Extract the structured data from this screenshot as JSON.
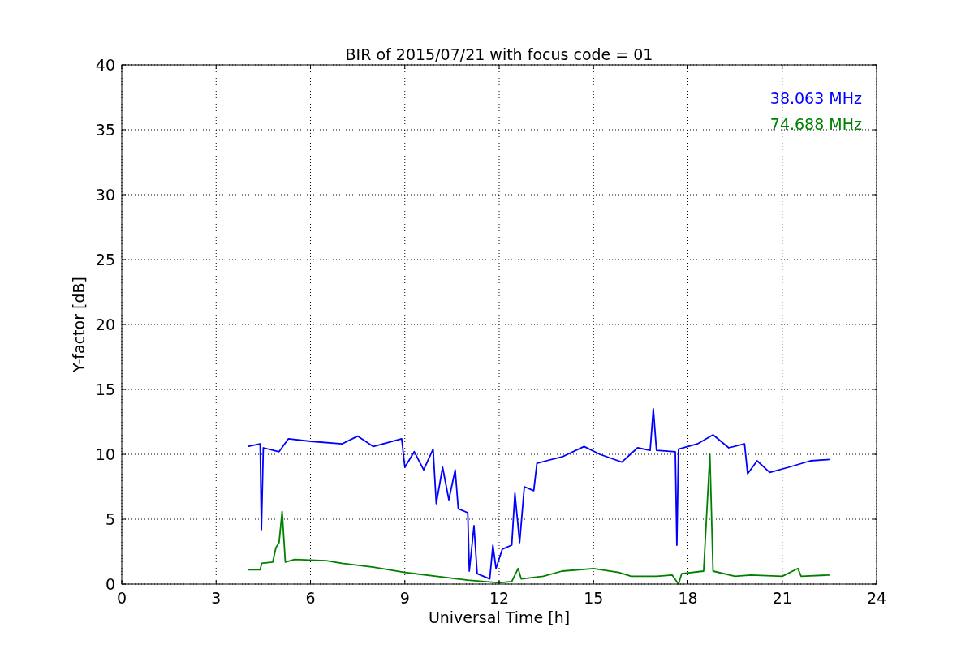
{
  "chart_data": {
    "type": "line",
    "title": "BIR of 2015/07/21 with focus code = 01",
    "xlabel": "Universal Time [h]",
    "ylabel": "Y-factor [dB]",
    "xlim": [
      0,
      24
    ],
    "ylim": [
      0,
      40
    ],
    "xticks": [
      0,
      3,
      6,
      9,
      12,
      15,
      18,
      21,
      24
    ],
    "yticks": [
      0,
      5,
      10,
      15,
      20,
      25,
      30,
      35,
      40
    ],
    "grid": true,
    "series": [
      {
        "name": "38.063 MHz",
        "color": "#0000ff",
        "x": [
          4.0,
          4.4,
          4.44,
          4.5,
          5.0,
          5.3,
          6.0,
          7.0,
          7.5,
          8.0,
          8.9,
          9.0,
          9.3,
          9.6,
          9.9,
          10.0,
          10.2,
          10.4,
          10.6,
          10.7,
          11.0,
          11.05,
          11.2,
          11.3,
          11.7,
          11.8,
          11.9,
          12.1,
          12.4,
          12.5,
          12.65,
          12.8,
          13.1,
          13.2,
          13.5,
          14.0,
          14.7,
          15.2,
          15.9,
          16.4,
          16.8,
          16.9,
          17.0,
          17.6,
          17.65,
          17.7,
          18.3,
          18.8,
          19.3,
          19.8,
          19.9,
          20.2,
          20.6,
          21.2,
          21.9,
          22.5
        ],
        "values": [
          10.6,
          10.8,
          4.2,
          10.5,
          10.2,
          11.2,
          11.0,
          10.8,
          11.4,
          10.6,
          11.2,
          9.0,
          10.2,
          8.8,
          10.4,
          6.2,
          9.0,
          6.5,
          8.8,
          5.8,
          5.5,
          1.0,
          4.5,
          0.8,
          0.4,
          3.0,
          1.2,
          2.7,
          3.0,
          7.0,
          3.2,
          7.5,
          7.2,
          9.3,
          9.5,
          9.8,
          10.6,
          10.0,
          9.4,
          10.5,
          10.3,
          13.5,
          10.3,
          10.2,
          3.0,
          10.4,
          10.8,
          11.5,
          10.5,
          10.8,
          8.5,
          9.5,
          8.6,
          9.0,
          9.5,
          9.6
        ]
      },
      {
        "name": "74.688 MHz",
        "color": "#008000",
        "x": [
          4.0,
          4.4,
          4.45,
          4.8,
          4.9,
          5.0,
          5.1,
          5.2,
          5.5,
          6.5,
          7.0,
          8.0,
          9.0,
          10.0,
          11.0,
          12.0,
          12.4,
          12.6,
          12.7,
          13.4,
          14.0,
          15.0,
          15.8,
          16.2,
          17.0,
          17.5,
          17.7,
          17.8,
          18.5,
          18.7,
          18.8,
          19.5,
          20.0,
          21.0,
          21.5,
          21.6,
          22.5
        ],
        "values": [
          1.1,
          1.1,
          1.6,
          1.7,
          2.8,
          3.2,
          5.6,
          1.7,
          1.9,
          1.8,
          1.6,
          1.3,
          0.9,
          0.6,
          0.3,
          0.1,
          0.2,
          1.2,
          0.4,
          0.6,
          1.0,
          1.2,
          0.9,
          0.6,
          0.6,
          0.7,
          0.0,
          0.8,
          1.0,
          10.0,
          1.0,
          0.6,
          0.7,
          0.6,
          1.2,
          0.6,
          0.7
        ]
      }
    ]
  }
}
